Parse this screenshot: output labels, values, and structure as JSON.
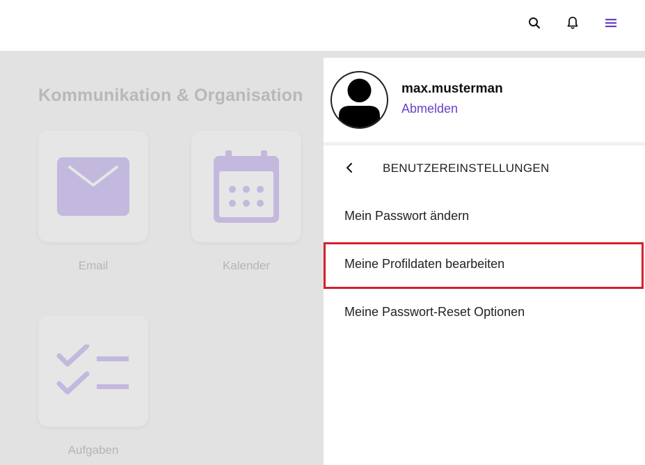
{
  "header": {
    "icons": [
      "search-icon",
      "bell-icon",
      "menu-icon"
    ],
    "accent_color": "#6a3fc8"
  },
  "background": {
    "section_title": "Kommunikation & Organisation",
    "tiles": [
      {
        "label": "Email",
        "icon": "mail-icon"
      },
      {
        "label": "Kalender",
        "icon": "calendar-icon"
      },
      {
        "label": "Aufgaben",
        "icon": "tasks-icon"
      }
    ],
    "icon_color": "#c3b8dd"
  },
  "drawer": {
    "username": "max.musterman",
    "logout_label": "Abmelden",
    "settings_title": "BENUTZEREINSTELLUNGEN",
    "items": [
      {
        "label": "Mein Passwort ändern"
      },
      {
        "label": "Meine Profildaten bearbeiten"
      },
      {
        "label": "Meine Passwort-Reset Optionen"
      }
    ],
    "highlight_color": "#d4202c"
  }
}
